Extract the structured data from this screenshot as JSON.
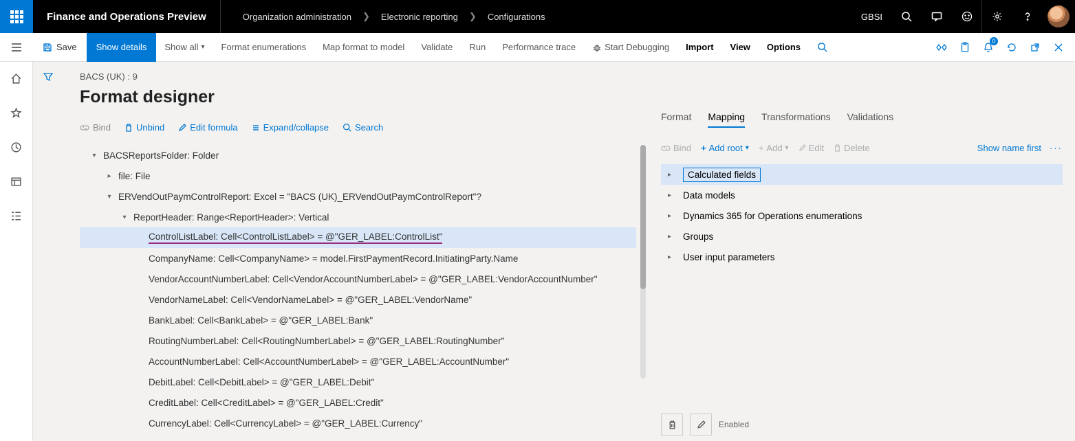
{
  "topbar": {
    "app_title": "Finance and Operations Preview",
    "breadcrumbs": [
      "Organization administration",
      "Electronic reporting",
      "Configurations"
    ],
    "company": "GBSI"
  },
  "cmdbar": {
    "save": "Save",
    "show_details": "Show details",
    "show_all": "Show all",
    "format_enum": "Format enumerations",
    "map_format": "Map format to model",
    "validate": "Validate",
    "run": "Run",
    "perf_trace": "Performance trace",
    "start_debug": "Start Debugging",
    "import": "Import",
    "view": "View",
    "options": "Options",
    "badge": "0"
  },
  "page": {
    "crumbline": "BACS (UK) : 9",
    "title": "Format designer"
  },
  "left_toolbar": {
    "bind": "Bind",
    "unbind": "Unbind",
    "edit_formula": "Edit formula",
    "expand": "Expand/collapse",
    "search": "Search"
  },
  "tree": [
    {
      "indent": 0,
      "chev": "▾",
      "label": "BACSReportsFolder: Folder",
      "sel": false
    },
    {
      "indent": 1,
      "chev": "▸",
      "label": "file: File",
      "sel": false
    },
    {
      "indent": 1,
      "chev": "▾",
      "label": "ERVendOutPaymControlReport: Excel = \"BACS (UK)_ERVendOutPaymControlReport\"?",
      "sel": false
    },
    {
      "indent": 2,
      "chev": "▾",
      "label": "ReportHeader: Range<ReportHeader>: Vertical",
      "sel": false
    },
    {
      "indent": 3,
      "chev": "",
      "label": "ControlListLabel: Cell<ControlListLabel> = @\"GER_LABEL:ControlList\"",
      "sel": true,
      "underline": true
    },
    {
      "indent": 3,
      "chev": "",
      "label": "CompanyName: Cell<CompanyName> = model.FirstPaymentRecord.InitiatingParty.Name",
      "sel": false
    },
    {
      "indent": 3,
      "chev": "",
      "label": "VendorAccountNumberLabel: Cell<VendorAccountNumberLabel> = @\"GER_LABEL:VendorAccountNumber\"",
      "sel": false
    },
    {
      "indent": 3,
      "chev": "",
      "label": "VendorNameLabel: Cell<VendorNameLabel> = @\"GER_LABEL:VendorName\"",
      "sel": false
    },
    {
      "indent": 3,
      "chev": "",
      "label": "BankLabel: Cell<BankLabel> = @\"GER_LABEL:Bank\"",
      "sel": false
    },
    {
      "indent": 3,
      "chev": "",
      "label": "RoutingNumberLabel: Cell<RoutingNumberLabel> = @\"GER_LABEL:RoutingNumber\"",
      "sel": false
    },
    {
      "indent": 3,
      "chev": "",
      "label": "AccountNumberLabel: Cell<AccountNumberLabel> = @\"GER_LABEL:AccountNumber\"",
      "sel": false
    },
    {
      "indent": 3,
      "chev": "",
      "label": "DebitLabel: Cell<DebitLabel> = @\"GER_LABEL:Debit\"",
      "sel": false
    },
    {
      "indent": 3,
      "chev": "",
      "label": "CreditLabel: Cell<CreditLabel> = @\"GER_LABEL:Credit\"",
      "sel": false
    },
    {
      "indent": 3,
      "chev": "",
      "label": "CurrencyLabel: Cell<CurrencyLabel> = @\"GER_LABEL:Currency\"",
      "sel": false
    }
  ],
  "rtabs": {
    "format": "Format",
    "mapping": "Mapping",
    "transformations": "Transformations",
    "validations": "Validations"
  },
  "rtoolbar": {
    "bind": "Bind",
    "add_root": "Add root",
    "add": "Add",
    "edit": "Edit",
    "delete": "Delete",
    "show_name": "Show name first"
  },
  "rtree": [
    {
      "label": "Calculated fields",
      "sel": true
    },
    {
      "label": "Data models",
      "sel": false
    },
    {
      "label": "Dynamics 365 for Operations enumerations",
      "sel": false
    },
    {
      "label": "Groups",
      "sel": false
    },
    {
      "label": "User input parameters",
      "sel": false
    }
  ],
  "enabled_label": "Enabled"
}
